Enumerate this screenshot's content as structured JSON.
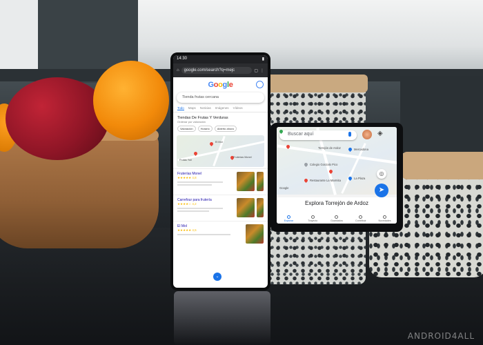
{
  "phone": {
    "status_time": "14:30",
    "url": "google.com/search?q=mejc",
    "google_logo": "Google",
    "search_query": "Tienda frutas cercana",
    "tabs": [
      "Todo",
      "Maps",
      "Noticias",
      "Imágenes",
      "Vídeos"
    ],
    "result_title": "Tiendas De Frutas Y Verduras",
    "result_subtitle": "Ordenar por valoración",
    "chips": [
      "Valoración",
      "Horario",
      "Abierto ahora"
    ],
    "map_labels": [
      "El Mol",
      "Fruterías Monel",
      "Frutas Yuli",
      "Carrefour Madrid"
    ],
    "listings": [
      {
        "name": "Fruterías Monel",
        "stars": "★★★★★ 4,8"
      },
      {
        "name": "Carrefour para frutería",
        "stars": "★★★★☆ 4,2"
      },
      {
        "name": "El Mol",
        "stars": "★★★★★ 4,5"
      }
    ]
  },
  "tablet": {
    "search_placeholder": "Buscar aquí",
    "map_labels": [
      "Torrejón de Ardoz",
      "Colegio Gonzalo Pico",
      "Restaurante La Marmita",
      "Mercadona",
      "Google",
      "La Plaza"
    ],
    "sheet_title": "Explora Torrejón de Ardoz",
    "nav": [
      {
        "label": "Explorar",
        "active": true
      },
      {
        "label": "Trayecto",
        "active": false
      },
      {
        "label": "Guardados",
        "active": false
      },
      {
        "label": "Contribuir",
        "active": false
      },
      {
        "label": "Novedades",
        "active": false
      }
    ]
  },
  "watermark": "ANDROID4ALL",
  "colors": {
    "google_blue": "#4285f4",
    "google_red": "#ea4335",
    "google_yellow": "#fbbc05",
    "google_green": "#34a853"
  }
}
